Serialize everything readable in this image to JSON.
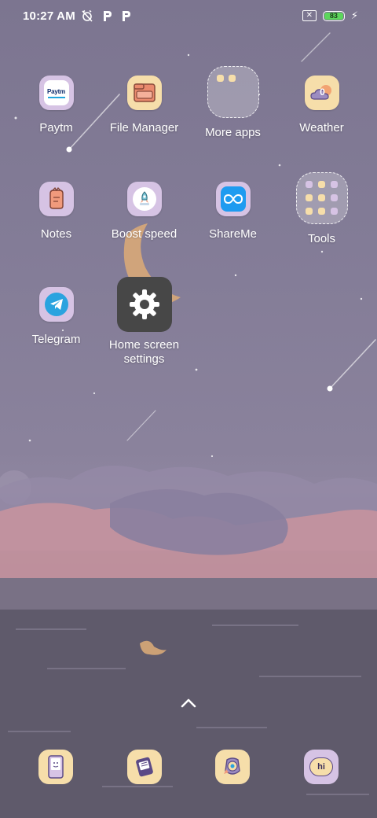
{
  "status_bar": {
    "time": "10:27 AM",
    "left_icons": [
      "alarm-off-icon",
      "p-notification-icon",
      "p-notification-icon"
    ],
    "battery_level": "83",
    "battery_color": "#5cd65c",
    "charging": true
  },
  "apps": [
    {
      "name": "Paytm",
      "icon": "paytm-icon"
    },
    {
      "name": "File Manager",
      "icon": "folder-icon"
    },
    {
      "name": "More apps",
      "icon": "folder-group"
    },
    {
      "name": "Weather",
      "icon": "weather-icon",
      "badge": "0"
    },
    {
      "name": "Notes",
      "icon": "notes-icon"
    },
    {
      "name": "Boost speed",
      "icon": "boost-speed-icon"
    },
    {
      "name": "ShareMe",
      "icon": "shareme-icon"
    },
    {
      "name": "Tools",
      "icon": "folder-group"
    },
    {
      "name": "Telegram",
      "icon": "telegram-icon"
    },
    {
      "name": "Home screen settings",
      "name_line1": "Home screen",
      "name_line2": "settings",
      "icon": "gear-icon"
    }
  ],
  "paytm_logo_text": "Paytm",
  "drawer_hint": "chevron-up-icon",
  "dock": [
    {
      "icon": "phone-icon"
    },
    {
      "icon": "messages-icon"
    },
    {
      "icon": "browser-icon"
    },
    {
      "icon": "chat-hi-icon",
      "text": "hi"
    }
  ],
  "colors": {
    "icon_tile_purple": "#d6c3e4",
    "icon_tile_cream": "#f6deaa",
    "settings_tile": "#474747",
    "telegram_blue": "#2aa3df",
    "shareme_blue": "#1e9bf0"
  }
}
